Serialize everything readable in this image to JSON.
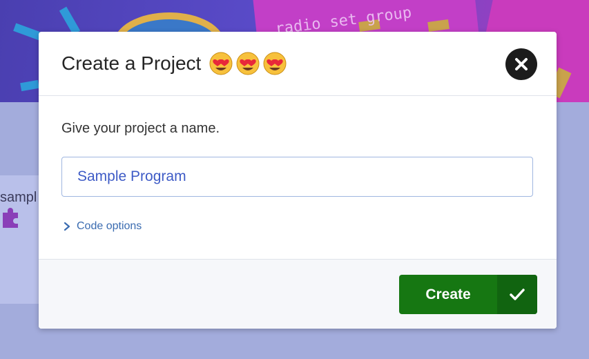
{
  "background": {
    "banner_text": "radio set group",
    "card_label": "sampl",
    "puzzle_icon": "puzzle-piece-icon"
  },
  "dialog": {
    "title": "Create a Project",
    "title_emojis": [
      "heart-eyes-emoji-icon",
      "heart-eyes-emoji-icon",
      "heart-eyes-emoji-icon"
    ],
    "close_icon": "close-icon",
    "prompt": "Give your project a name.",
    "name_input": {
      "value": "Sample Program",
      "placeholder": ""
    },
    "code_options_label": "Code options",
    "code_options_icon": "chevron-right-icon",
    "create_button": {
      "label": "Create",
      "icon": "checkmark-icon"
    }
  },
  "colors": {
    "primary_green": "#167712",
    "primary_green_dark": "#116410",
    "link_blue": "#3a6bb0",
    "input_text": "#3e5bc6"
  }
}
